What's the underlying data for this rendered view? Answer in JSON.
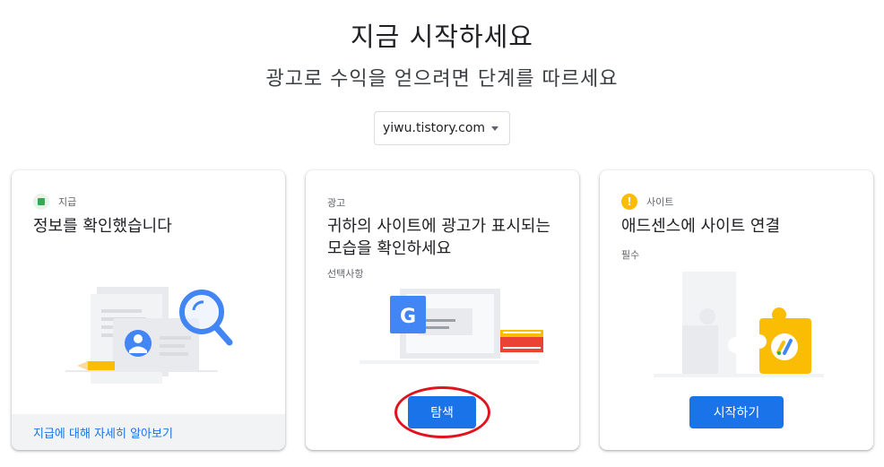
{
  "header": {
    "title": "지금 시작하세요",
    "subtitle": "광고로 수익을 얻으려면 단계를 따르세요"
  },
  "site_selector": {
    "selected": "yiwu.tistory.com",
    "icon": "dropdown-caret-icon"
  },
  "cards": [
    {
      "tag": "지급",
      "status": "complete",
      "status_color": "#34a853",
      "heading": "정보를 확인했습니다",
      "footer_link": "지급에 대해 자세히 알아보기"
    },
    {
      "tag": "광고",
      "heading": "귀하의 사이트에 광고가 표시되는 모습을 확인하세요",
      "note": "선택사항",
      "button": "탐색",
      "illustration_letter": "G"
    },
    {
      "tag": "사이트",
      "status": "warning",
      "status_color": "#fbbc04",
      "status_symbol": "!",
      "heading": "애드센스에 사이트 연결",
      "note": "필수",
      "button": "시작하기"
    }
  ],
  "colors": {
    "accent": "#1a73e8",
    "annotation": "#e0141e"
  }
}
